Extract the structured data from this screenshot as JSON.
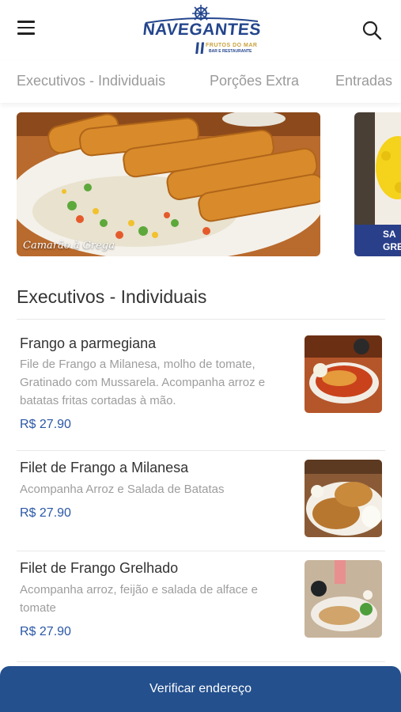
{
  "header": {
    "logo_text": "NAVEGANTES II",
    "logo_subtitle": "FRUTOS DO MAR",
    "logo_tagline": "BAR E RESTAURANTE"
  },
  "tabs": [
    {
      "label": "Executivos - Individuais"
    },
    {
      "label": "Porções Extra"
    },
    {
      "label": "Entradas"
    }
  ],
  "banners": [
    {
      "caption": "Camarão à Grega"
    },
    {
      "caption": "SA\nGRE"
    }
  ],
  "section": {
    "title": "Executivos - Individuais",
    "items": [
      {
        "name": "Frango a parmegiana",
        "description": "File de Frango a Milanesa, molho de tomate, Gratinado com Mussarela. Acompanha arroz e batatas fritas cortadas à mão.",
        "price": "R$ 27.90"
      },
      {
        "name": "Filet de Frango a Milanesa",
        "description": "Acompanha Arroz e Salada de Batatas",
        "price": "R$ 27.90"
      },
      {
        "name": "Filet de Frango Grelhado",
        "description": "Acompanha arroz, feijão e salada de alface e tomate",
        "price": "R$ 27.90"
      }
    ]
  },
  "footer": {
    "button_label": "Verificar endereço"
  },
  "colors": {
    "brand": "#24468d",
    "price": "#2a57a6",
    "bottom_bar": "#24508e",
    "logo_gold": "#c9a13b"
  }
}
